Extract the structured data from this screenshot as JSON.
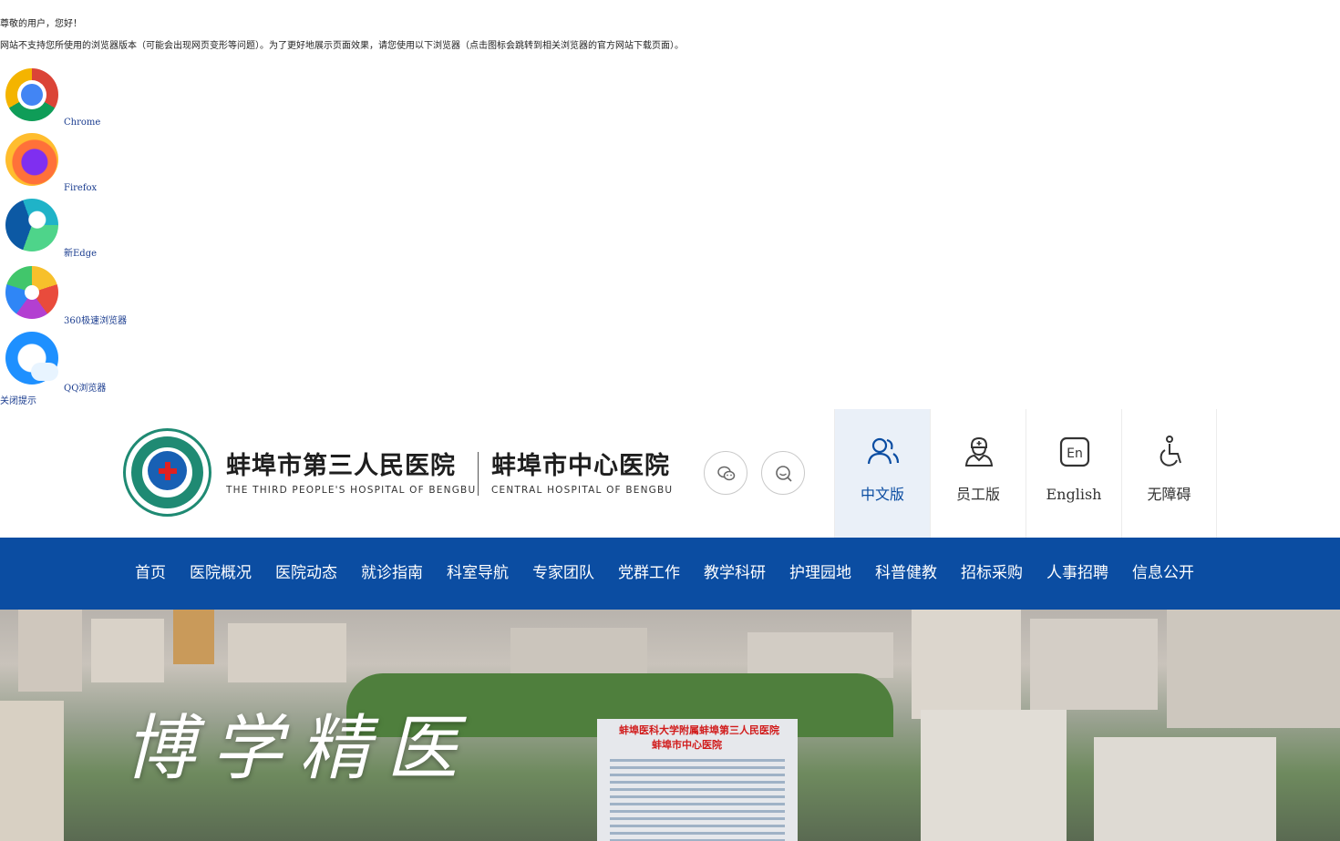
{
  "notice": {
    "greeting": "尊敬的用户，您好！",
    "tip": "网站不支持您所使用的浏览器版本（可能会出现网页变形等问题）。为了更好地展示页面效果，请您使用以下浏览器（点击图标会跳转到相关浏览器的官方网站下载页面）。",
    "browsers": [
      {
        "name": "Chrome",
        "icon": "chrome-icon"
      },
      {
        "name": "Firefox",
        "icon": "firefox-icon"
      },
      {
        "name": "新Edge",
        "icon": "edge-icon"
      },
      {
        "name": "360极速浏览器",
        "icon": "360-browser-icon"
      },
      {
        "name": "QQ浏览器",
        "icon": "qq-browser-icon"
      }
    ],
    "close_label": "关闭提示"
  },
  "header": {
    "name_1": "蚌埠市第三人民医院",
    "sub_1": "THE THIRD PEOPLE'S HOSPITAL OF BENGBU",
    "name_2": "蚌埠市中心医院",
    "sub_2": "CENTRAL HOSPITAL OF BENGBU",
    "buttons": [
      {
        "icon": "wechat-icon"
      },
      {
        "icon": "search-icon"
      }
    ],
    "version_tabs": [
      {
        "label": "中文版",
        "icon": "users-icon",
        "active": true
      },
      {
        "label": "员工版",
        "icon": "doctor-icon",
        "active": false
      },
      {
        "label": "English",
        "icon": "en-icon",
        "active": false
      },
      {
        "label": "无障碍",
        "icon": "wheelchair-icon",
        "active": false
      }
    ]
  },
  "nav": {
    "items": [
      "首页",
      "医院概况",
      "医院动态",
      "就诊指南",
      "科室导航",
      "专家团队",
      "党群工作",
      "教学科研",
      "护理园地",
      "科普健教",
      "招标采购",
      "人事招聘",
      "信息公开"
    ]
  },
  "hero": {
    "slogan": "博学精医",
    "building_sign_1": "蚌埠医科大学附属蚌埠第三人民医院",
    "building_sign_2": "蚌埠市中心医院"
  },
  "colors": {
    "primary": "#0b4da2",
    "active_tab_bg": "#eaf0f8",
    "link": "#1a3c8f",
    "emblem_green": "#1f8a73",
    "cross_red": "#e02020"
  }
}
